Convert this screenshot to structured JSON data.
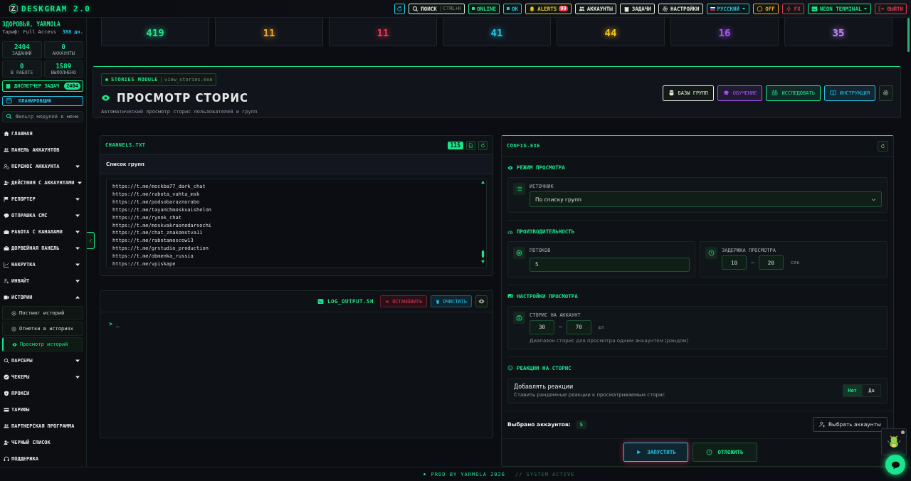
{
  "topbar": {
    "brand": "DESKGRAM 2.0",
    "items": [
      {
        "kind": "icon",
        "color": "#22c3e6"
      },
      {
        "kind": "search",
        "label": "ПОИСК",
        "shortcut": "CTRL+K",
        "color": "#e6e6e6"
      },
      {
        "kind": "status",
        "label": "ONLINE",
        "color": "#19e68c"
      },
      {
        "kind": "status",
        "label": "OK",
        "color": "#22c3e6"
      },
      {
        "kind": "alerts",
        "label": "ALERTS",
        "badge": "99",
        "color": "#f5c518"
      },
      {
        "kind": "button",
        "label": "АККАУНТЫ",
        "color": "#e6e6e6"
      },
      {
        "kind": "button",
        "label": "ЗАДАЧИ",
        "color": "#e6e6e6"
      },
      {
        "kind": "button",
        "label": "НАСТРОЙКИ",
        "color": "#e6e6e6"
      },
      {
        "kind": "dropdown",
        "label": "РУССКИЙ",
        "color": "#22c3e6"
      },
      {
        "kind": "button",
        "label": "OFF",
        "color": "#f5a524"
      },
      {
        "kind": "button",
        "label": "FX",
        "color": "#e0365a"
      },
      {
        "kind": "dropdown",
        "label": "NEON TERMINAL",
        "color": "#19e68c"
      },
      {
        "kind": "button",
        "label": "ВЫЙТИ",
        "color": "#e0365a"
      }
    ]
  },
  "sidebar": {
    "greeting": "ЗДОРОВЬЯ, YARMOLA",
    "plan": "Тариф: Full Access",
    "days": "388 дн.",
    "stats": [
      {
        "value": "2404",
        "label": "ЗАДАНИЙ"
      },
      {
        "value": "0",
        "label": "АККАУНТЫ"
      },
      {
        "value": "0",
        "label": "В РАБОТЕ"
      },
      {
        "value": "1589",
        "label": "ВЫПОЛНЕНО"
      }
    ],
    "dispatcher": {
      "label": "ДИСПЕТЧЕР ЗАДАЧ",
      "badge": "2404"
    },
    "planner": {
      "label": "ПЛАНИРОВЩИК"
    },
    "filter": {
      "placeholder": "Фильтр модулей в меню"
    },
    "items": [
      {
        "label": "ГЛАВНАЯ",
        "kind": "link"
      },
      {
        "label": "ПАНЕЛЬ АККАУНТОВ",
        "kind": "link"
      },
      {
        "label": "ПЕРЕНОС АККАУНТА",
        "kind": "group",
        "expanded": false
      },
      {
        "label": "ДЕЙСТВИЯ С АККАУНТАМИ",
        "kind": "group",
        "expanded": false
      },
      {
        "label": "РЕПОРТЕР",
        "kind": "group",
        "expanded": false
      },
      {
        "label": "ОТПРАВКА СМС",
        "kind": "group",
        "expanded": false
      },
      {
        "label": "РАБОТА С КАНАЛАМИ",
        "kind": "group",
        "expanded": false
      },
      {
        "label": "ДОРВЕЙНАЯ ПАНЕЛЬ",
        "kind": "group",
        "expanded": false
      },
      {
        "label": "НАКРУТКА",
        "kind": "group",
        "expanded": false
      },
      {
        "label": "ИНВАЙТ",
        "kind": "group",
        "expanded": false
      },
      {
        "label": "ИСТОРИИ",
        "kind": "group",
        "expanded": true,
        "children": [
          {
            "label": "Постинг историй",
            "selected": false
          },
          {
            "label": "Отметки в историях",
            "selected": false
          },
          {
            "label": "Просмотр историй",
            "selected": true
          }
        ]
      },
      {
        "label": "ПАРСЕРЫ",
        "kind": "group",
        "expanded": false
      },
      {
        "label": "ЧЕКЕРЫ",
        "kind": "group",
        "expanded": false
      },
      {
        "label": "ПРОКСИ",
        "kind": "link"
      },
      {
        "label": "ТАРИФЫ",
        "kind": "link"
      },
      {
        "label": "ПАРТНЕРСКАЯ ПРОГРАММА",
        "kind": "link"
      },
      {
        "label": "ЧЕРНЫЙ СПИСОК",
        "kind": "link"
      },
      {
        "label": "ПОДДЕРЖКА",
        "kind": "link"
      }
    ]
  },
  "stats": [
    {
      "value": "419",
      "color": "#19e68c"
    },
    {
      "value": "11",
      "color": "#f5a524"
    },
    {
      "value": "11",
      "color": "#f0365a"
    },
    {
      "value": "41",
      "color": "#22c3e6"
    },
    {
      "value": "44",
      "color": "#f5c518"
    },
    {
      "value": "16",
      "color": "#a855f7"
    },
    {
      "value": "35",
      "color": "#c084fc"
    }
  ],
  "header": {
    "module": "STORIES MODULE",
    "file": "view_stories.exe",
    "title": "ПРОСМОТР СТОРИС",
    "subtitle": "Автоматический просмотр сторис пользователей и групп",
    "buttons": [
      {
        "label": "БАЗЫ ГРУПП",
        "color": "#e6e6e6"
      },
      {
        "label": "ОБУЧЕНИЕ",
        "color": "#a855f7"
      },
      {
        "label": "ИССЛЕДОВАТЬ",
        "color": "#19e68c"
      },
      {
        "label": "ИНСТРУКЦИЯ",
        "color": "#22c3e6"
      }
    ]
  },
  "channels": {
    "title": "CHANNELS.TXT",
    "count": "115",
    "subtitle": "Список групп",
    "lines": [
      "https://t.me/mockba77_dark_chat",
      "https://t.me/rabota_vahta_msk",
      "https://t.me/podsobaraznorabo",
      "https://t.me/tayanchmoskvaishelon",
      "https://t.me/rynok_chat",
      "https://t.me/moskvakrasnodarsochi",
      "https://t.me/chat_znakomstva11",
      "https://t.me/rabotamoscow13",
      "https://t.me/grstudio_production",
      "https://t.me/obmenka_russia",
      "https://t.me/vpiskape"
    ]
  },
  "log": {
    "title": "LOG_OUTPUT.SH",
    "stop": "ОСТАНОВИТЬ",
    "clear": "ОЧИСТИТЬ",
    "prompt": ">",
    "cursor": "_"
  },
  "config": {
    "title": "CONFIG.EXE",
    "mode": {
      "heading": "РЕЖИМ ПРОСМОТРА",
      "label": "ИСТОЧНИК",
      "value": "По списку групп"
    },
    "performance": {
      "heading": "ПРОИЗВОДИТЕЛЬНОСТЬ",
      "threads_label": "ПОТОКОВ",
      "threads": "5",
      "delay_label": "ЗАДЕРЖКА ПРОСМОТРА",
      "delay_from": "10",
      "separator": "—",
      "delay_to": "20",
      "delay_unit": "сек"
    },
    "view": {
      "heading": "НАСТРОЙКИ ПРОСМОТРА",
      "label": "СТОРИС НА АККАУНТ",
      "from": "30",
      "separator": "—",
      "to": "70",
      "unit": "шт",
      "hint": "Диапазон сторис для просмотра одним аккаунтом (рандом)"
    },
    "reactions": {
      "heading": "РЕАКЦИИ НА СТОРИС",
      "title": "Добавлять реакции",
      "description": "Ставить рандомные реакции к просматриваемым сторис",
      "options": [
        {
          "label": "Нет",
          "selected": true
        },
        {
          "label": "Да",
          "selected": false
        }
      ]
    },
    "selected_label": "Выбрано аккаунтов:",
    "selected_count": "5",
    "choose": "Выбрать аккаунты",
    "start": "ЗАПУСТИТЬ",
    "later": "ОТЛОЖИТЬ"
  },
  "footer": {
    "credit": "PROD BY YARMOLA 2026",
    "status": "// SYSTEM ACTIVE"
  }
}
